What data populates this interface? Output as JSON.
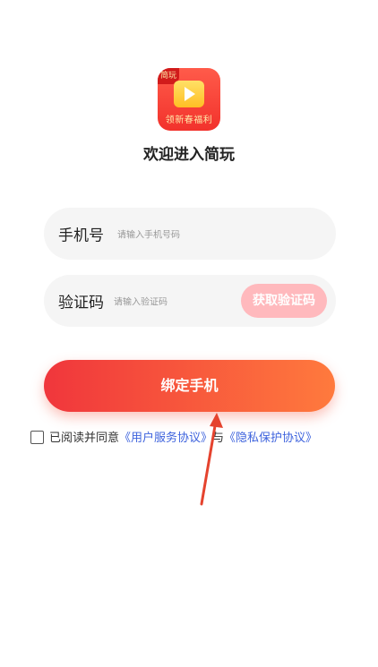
{
  "app": {
    "logo_badge": "简玩",
    "logo_caption": "领新春福利",
    "welcome_title": "欢迎进入简玩"
  },
  "form": {
    "phone_label": "手机号",
    "phone_placeholder": "请输入手机号码",
    "code_label": "验证码",
    "code_placeholder": "请输入验证码",
    "get_code_button": "获取验证码",
    "bind_button": "绑定手机"
  },
  "agreement": {
    "checked": false,
    "prefix": "已阅读并同意",
    "user_agreement": "《用户服务协议》",
    "joiner": "与",
    "privacy_agreement": "《隐私保护协议》"
  },
  "colors": {
    "primary_gradient_start": "#f0363c",
    "primary_gradient_end": "#ff7a3d",
    "get_code_bg": "#ffb9bd",
    "link": "#3e63dd",
    "annotation_arrow": "#e5432e"
  },
  "annotation": {
    "icon": "red-arrow-pointing-up"
  }
}
